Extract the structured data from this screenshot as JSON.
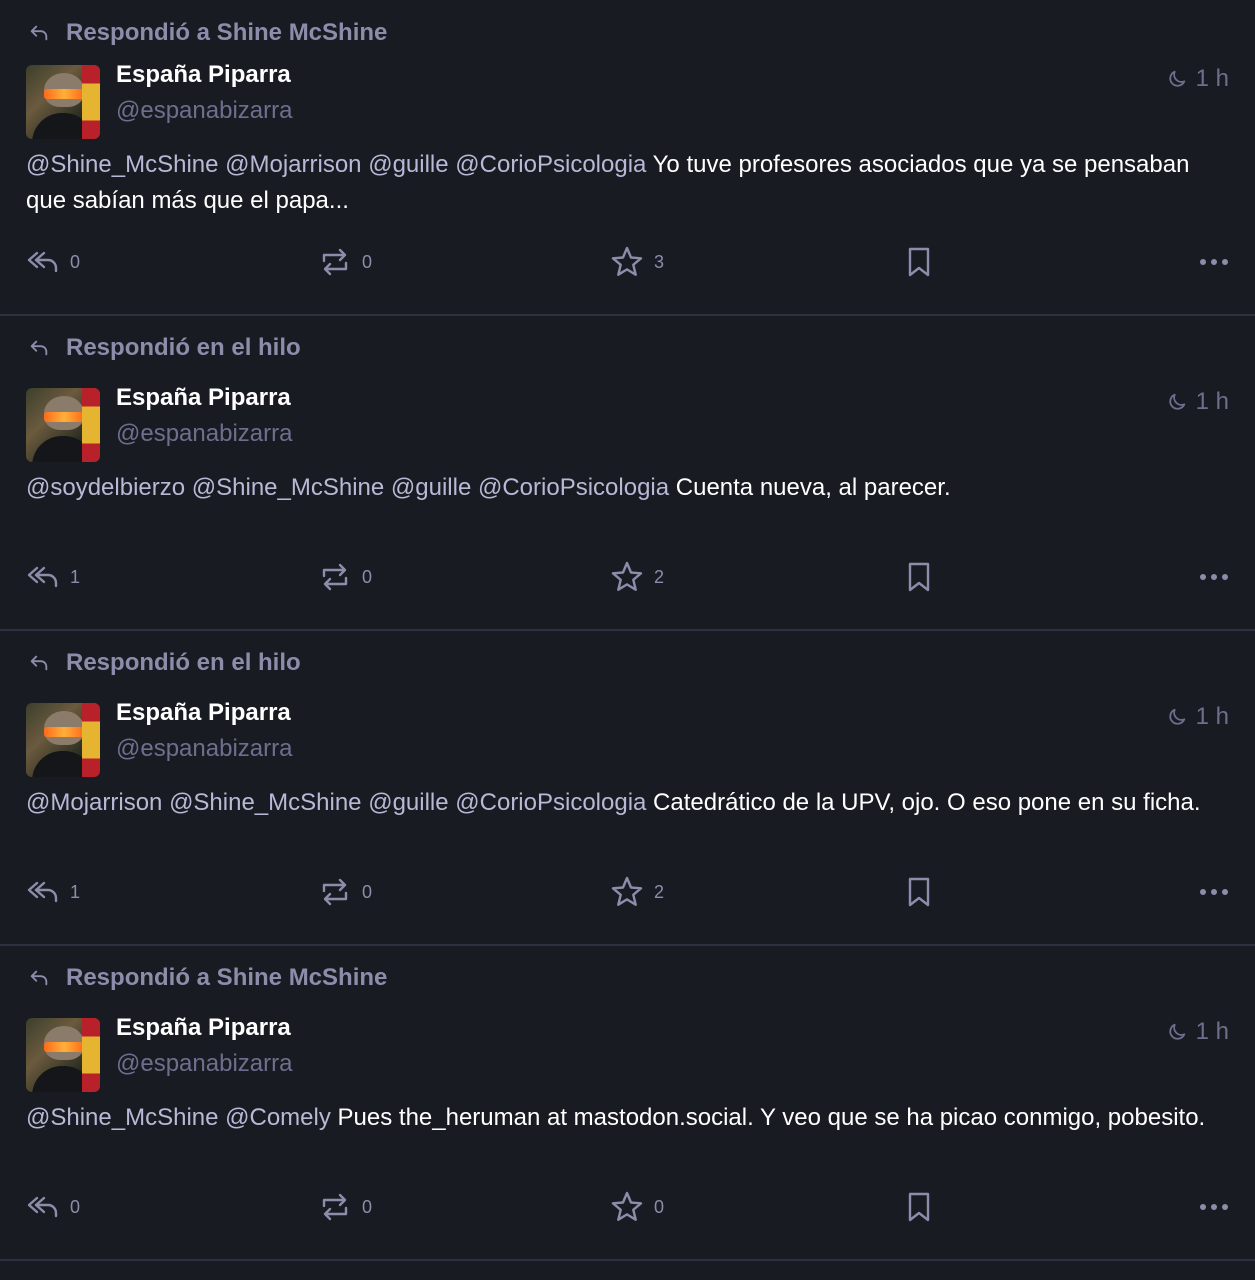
{
  "labels": {
    "replied_to_prefix": "Respondió a",
    "replied_in_thread": "Respondió en el hilo"
  },
  "colors": {
    "background": "#191b22",
    "muted": "#8c8dab",
    "handle": "#6e6f8e",
    "divider": "#2e3040"
  },
  "posts": [
    {
      "prepend": "Respondió a Shine McShine",
      "author": {
        "name": "España Piparra",
        "handle": "@espanabizarra"
      },
      "time": "1 h",
      "mentions": "@Shine_McShine @Mojarrison @guille @CorioPsicologia",
      "text": " Yo tuve profesores asociados que ya se pensaban que sabían más que el papa...",
      "counts": {
        "replies": "0",
        "boosts": "0",
        "favourites": "3"
      }
    },
    {
      "prepend": "Respondió en el hilo",
      "author": {
        "name": "España Piparra",
        "handle": "@espanabizarra"
      },
      "time": "1 h",
      "mentions": "@soydelbierzo @Shine_McShine @guille @CorioPsicologia",
      "text": " Cuenta nueva, al parecer.",
      "counts": {
        "replies": "1",
        "boosts": "0",
        "favourites": "2"
      }
    },
    {
      "prepend": "Respondió en el hilo",
      "author": {
        "name": "España Piparra",
        "handle": "@espanabizarra"
      },
      "time": "1 h",
      "mentions": "@Mojarrison @Shine_McShine @guille @CorioPsicologia",
      "text": " Catedrático de la UPV, ojo. O eso pone en su ficha.",
      "counts": {
        "replies": "1",
        "boosts": "0",
        "favourites": "2"
      }
    },
    {
      "prepend": "Respondió a Shine McShine",
      "author": {
        "name": "España Piparra",
        "handle": "@espanabizarra"
      },
      "time": "1 h",
      "mentions": "@Shine_McShine @Comely",
      "text": " Pues the_heruman at mastodon.social. Y veo que se ha picao conmigo, pobesito.",
      "counts": {
        "replies": "0",
        "boosts": "0",
        "favourites": "0"
      }
    }
  ],
  "icons": {
    "prepend": "reply-arrow-icon",
    "time": "moon-icon",
    "reply": "reply-all-icon",
    "boost": "boost-icon",
    "favourite": "star-icon",
    "bookmark": "bookmark-icon",
    "more": "more-horizontal-icon"
  }
}
